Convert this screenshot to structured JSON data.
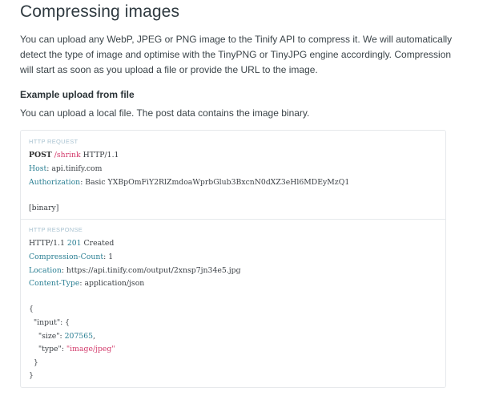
{
  "heading": "Compressing images",
  "intro": "You can upload any WebP, JPEG or PNG image to the Tinify API to compress it. We will automatically detect the type of image and optimise with the TinyPNG or TinyJPG engine accordingly. Compression will start as soon as you upload a file or provide the URL to the image.",
  "example": {
    "title": "Example upload from file",
    "lead": "You can upload a local file. The post data contains the image binary."
  },
  "request": {
    "label": "HTTP REQUEST",
    "method": "POST",
    "path": "/shrink",
    "version": "HTTP/1.1",
    "host_key": "Host",
    "host_val": "api.tinify.com",
    "auth_key": "Authorization",
    "auth_val": "Basic YXBpOmFiY2RlZmdoaWprbGlub3BxcnN0dXZ3eHl6MDEyMzQ1",
    "body": "[binary]"
  },
  "response": {
    "label": "HTTP RESPONSE",
    "status_version": "HTTP/1.1",
    "status_code": "201",
    "status_text": "Created",
    "cc_key": "Compression-Count",
    "cc_val": "1",
    "loc_key": "Location",
    "loc_val": "https://api.tinify.com/output/2xnsp7jn34e5.jpg",
    "ct_key": "Content-Type",
    "ct_val": "application/json",
    "json_open": "{",
    "input_line": "  \"input\": {",
    "size_key": "    \"size\": ",
    "size_val": "207565",
    "size_comma": ",",
    "type_key": "    \"type\": ",
    "type_val": "\"image/jpeg\"",
    "inner_close": "  }",
    "json_close": "}"
  }
}
